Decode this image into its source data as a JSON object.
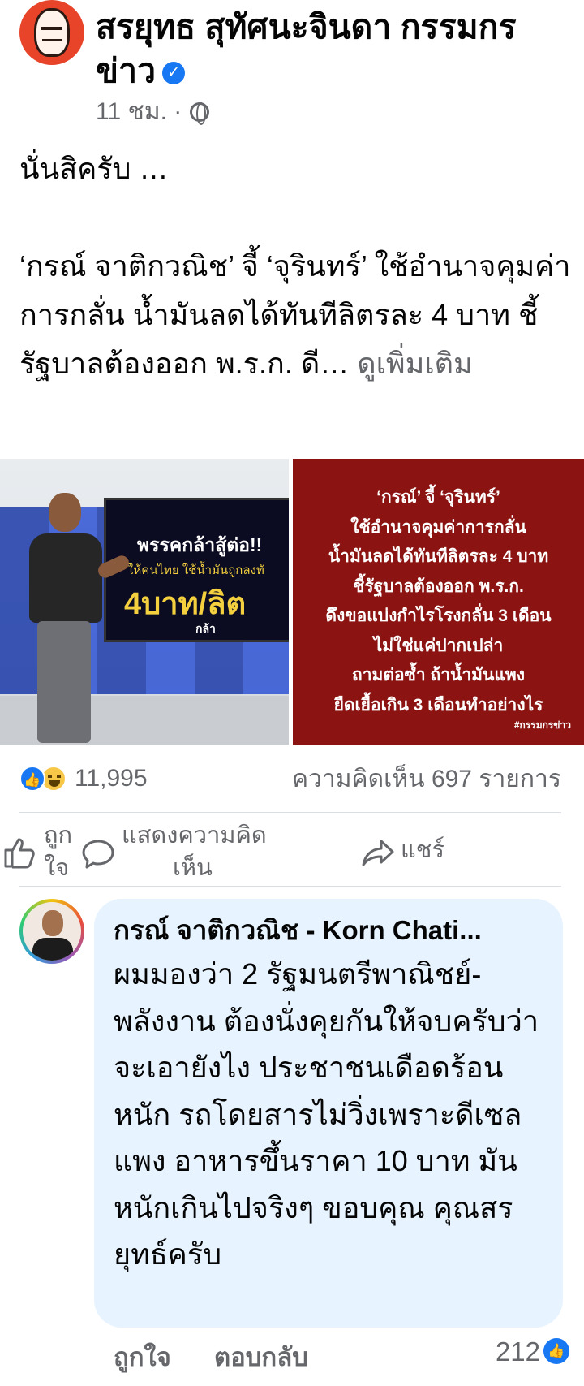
{
  "post": {
    "author": "สรยุทธ สุทัศนะจินดา กรรมกรข่าว",
    "verified_symbol": "✓",
    "time": "11 ชม. ·",
    "text_line1": "นั่นสิครับ …",
    "text_line2": "‘กรณ์ จาติกวณิช’ จี้ ‘จุรินทร์’ ใช้อำนาจคุมค่าการกลั่น น้ำมันลดได้ทันทีลิตรละ 4 บาท ชี้รัฐบาลต้องออก พ.ร.ก. ดี…",
    "see_more": "ดูเพิ่มเติม"
  },
  "images": {
    "left": {
      "screen_line1": "พรรคกล้าสู้ต่อ!!",
      "screen_line2": "ให้คนไทย ใช้น้ำมันถูกลงทั",
      "screen_line3": "4บาท/ลิต",
      "screen_logo": "กล้า"
    },
    "right": {
      "lines": [
        "‘กรณ์’ จี้ ‘จุรินทร์’",
        "ใช้อำนาจคุมค่าการกลั่น",
        "น้ำมันลดได้ทันทีลิตรละ 4 บาท",
        "ชี้รัฐบาลต้องออก พ.ร.ก.",
        "ดึงขอแบ่งกำไรโรงกลั่น 3 เดือน",
        "ไม่ใช่แค่ปากเปล่า",
        "ถามต่อซ้ำ ถ้าน้ำมันแพง",
        "ยืดเยื้อเกิน 3 เดือนทำอย่างไร"
      ],
      "tag": "#กรรมกรข่าว"
    }
  },
  "stats": {
    "reaction_count": "11,995",
    "comments": "ความคิดเห็น 697 รายการ"
  },
  "actions": {
    "like_line1": "ถูก",
    "like_line2": "ใจ",
    "comment_line1": "แสดงความคิด",
    "comment_line2": "เห็น",
    "share": "แชร์"
  },
  "comment": {
    "name": "กรณ์ จาติกวณิช - Korn Chati...",
    "text": "ผมมองว่า 2 รัฐมนตรีพาณิชย์-พลังงาน ต้องนั่งคุยกันให้จบครับว่าจะเอายังไง ประชาชนเดือดร้อนหนัก รถโดยสารไม่วิ่งเพราะดีเซลแพง อาหารขึ้นราคา 10 บาท มันหนักเกินไปจริงๆ ขอบคุณ คุณสรยุทธ์ครับ",
    "like": "ถูกใจ",
    "reply": "ตอบกลับ",
    "like_count": "212"
  },
  "colors": {
    "brand_blue": "#1877f2",
    "secondary_text": "#65676b",
    "comment_bubble": "#e7f3ff",
    "image_red": "#8b1412"
  },
  "icons": [
    "verified-badge-icon",
    "globe-icon",
    "like-reaction-icon",
    "haha-reaction-icon",
    "thumbs-up-icon",
    "comment-icon",
    "share-arrow-icon"
  ]
}
